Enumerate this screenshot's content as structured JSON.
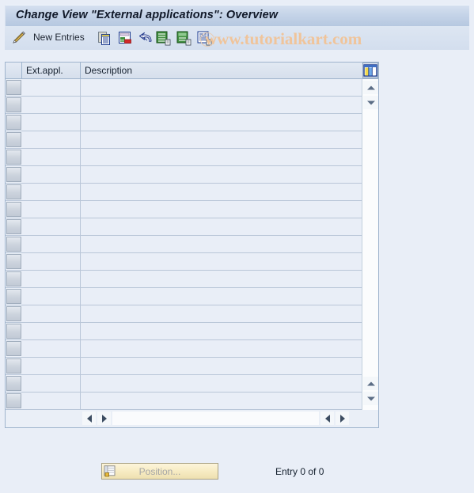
{
  "window": {
    "title": "Change View \"External applications\": Overview"
  },
  "toolbar": {
    "edit_icon": "pencil-icon",
    "new_entries_label": "New Entries",
    "buttons": [
      {
        "name": "copy-as-button",
        "icon": "copy-icon"
      },
      {
        "name": "delete-button",
        "icon": "delete-row-icon"
      },
      {
        "name": "undo-button",
        "icon": "undo-arrow-icon"
      },
      {
        "name": "select-all-button",
        "icon": "select-all-icon"
      },
      {
        "name": "select-block-button",
        "icon": "select-block-icon"
      },
      {
        "name": "deselect-all-button",
        "icon": "deselect-all-icon"
      }
    ],
    "watermark": "www.tutorialkart.com",
    "watermark_color": "#f0c49a"
  },
  "table": {
    "columns": [
      {
        "key": "ext_appl",
        "label": "Ext.appl."
      },
      {
        "key": "description",
        "label": "Description"
      }
    ],
    "config_icon": "table-settings-icon",
    "rows": [
      {
        "ext_appl": "",
        "description": ""
      },
      {
        "ext_appl": "",
        "description": ""
      },
      {
        "ext_appl": "",
        "description": ""
      },
      {
        "ext_appl": "",
        "description": ""
      },
      {
        "ext_appl": "",
        "description": ""
      },
      {
        "ext_appl": "",
        "description": ""
      },
      {
        "ext_appl": "",
        "description": ""
      },
      {
        "ext_appl": "",
        "description": ""
      },
      {
        "ext_appl": "",
        "description": ""
      },
      {
        "ext_appl": "",
        "description": ""
      },
      {
        "ext_appl": "",
        "description": ""
      },
      {
        "ext_appl": "",
        "description": ""
      },
      {
        "ext_appl": "",
        "description": ""
      },
      {
        "ext_appl": "",
        "description": ""
      },
      {
        "ext_appl": "",
        "description": ""
      },
      {
        "ext_appl": "",
        "description": ""
      },
      {
        "ext_appl": "",
        "description": ""
      },
      {
        "ext_appl": "",
        "description": ""
      },
      {
        "ext_appl": "",
        "description": ""
      }
    ],
    "row_count": 19,
    "scroll": {
      "up_icon": "triangle-up-icon",
      "down_icon": "triangle-down-icon",
      "left_icon": "triangle-left-icon",
      "right_icon": "triangle-right-icon"
    }
  },
  "footer": {
    "position_button_label": "Position...",
    "position_button_icon": "position-icon",
    "position_button_enabled": false,
    "entry_status": "Entry 0 of 0"
  },
  "colors": {
    "background": "#e9eef7",
    "title_gradient_top": "#d5e0ef",
    "title_gradient_bottom": "#b6c8e0",
    "panel_border": "#9fb4cd",
    "grid_line": "#b9c6d8",
    "cell_fill": "#e9eef7",
    "button_cream": "#f7ecc4",
    "disabled_text": "#a6a6a6"
  }
}
